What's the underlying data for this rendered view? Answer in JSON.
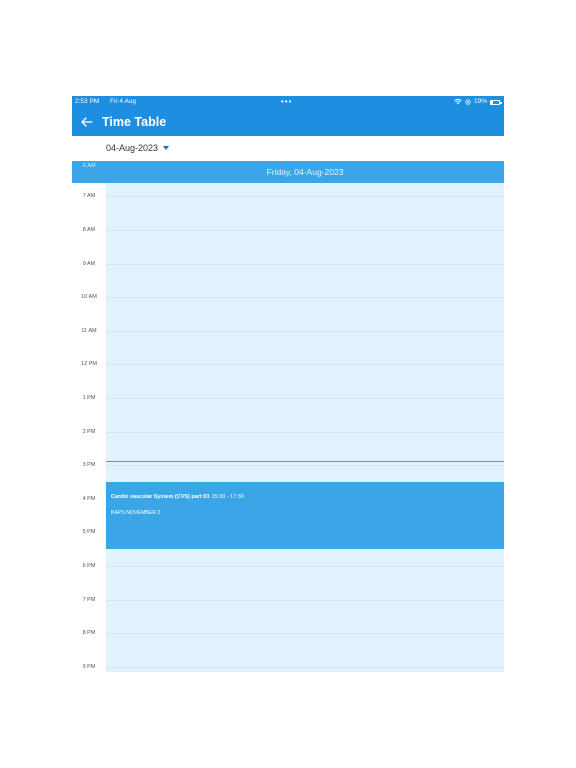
{
  "status_bar": {
    "time": "2:53 PM",
    "date": "Fri 4 Aug",
    "dots": "•••",
    "battery": "19%",
    "battery_level": 0.19,
    "icons": [
      "wifi-icon",
      "orientation-lock-icon",
      "battery-icon"
    ]
  },
  "app_bar": {
    "title": "Time Table",
    "back_icon": "arrow-left-icon"
  },
  "date_picker": {
    "selected": "04-Aug-2023",
    "icon": "caret-down-icon"
  },
  "day_header": {
    "label": "Friday, 04-Aug-2023",
    "partial_hour": "6 AM"
  },
  "calendar": {
    "hours": [
      "7 AM",
      "8 AM",
      "9 AM",
      "10 AM",
      "11 AM",
      "12 PM",
      "1 PM",
      "2 PM",
      "3 PM",
      "4 PM",
      "5 PM",
      "6 PM",
      "7 PM",
      "8 PM",
      "9 PM"
    ],
    "current_time": "2:53 PM",
    "events": [
      {
        "title": "Cardio vascular System (CVS) part 03",
        "time": "15:30 - 17:30",
        "subtitle": "KAPS NOVEMBER 2",
        "start_hour": 15.5,
        "end_hour": 17.5
      }
    ]
  },
  "colors": {
    "primary": "#1e8fe0",
    "header": "#3aa6e8",
    "grid_background": "#e3f3fe",
    "event": "#3aa6e8",
    "now_line": "#e06070"
  }
}
